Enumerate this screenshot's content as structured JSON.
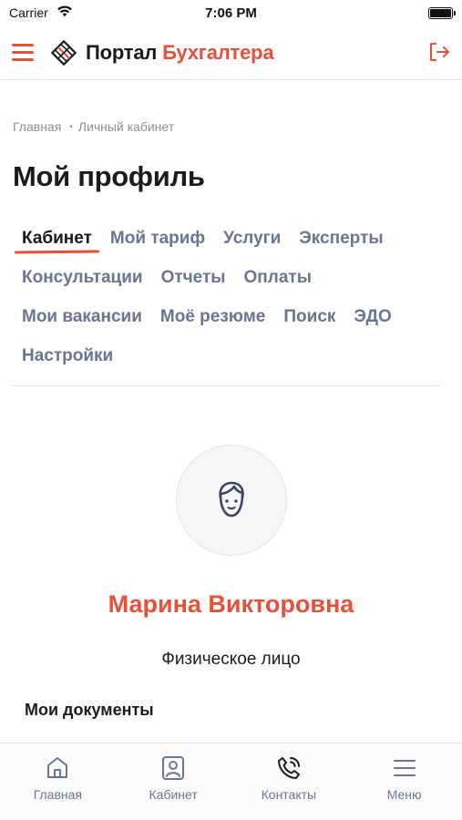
{
  "status_bar": {
    "carrier": "Carrier",
    "time": "7:06 PM",
    "battery_level": 1.0
  },
  "header": {
    "logo_text_primary": "Портал",
    "logo_text_accent": "Бухгалтера",
    "menu_icon": "hamburger-icon",
    "exit_icon": "logout-icon",
    "accent_color": "#e8503a"
  },
  "breadcrumb": {
    "home": "Главная",
    "current": "Личный кабинет"
  },
  "page_title": "Мой профиль",
  "tabs": [
    [
      {
        "label": "Кабинет",
        "active": true
      },
      {
        "label": "Мой тариф"
      },
      {
        "label": "Услуги"
      },
      {
        "label": "Эксперты"
      }
    ],
    [
      {
        "label": "Консультации"
      },
      {
        "label": "Отчеты"
      },
      {
        "label": "Оплаты"
      }
    ],
    [
      {
        "label": "Мои вакансии"
      },
      {
        "label": "Моё резюме"
      },
      {
        "label": "Поиск"
      },
      {
        "label": "ЭДО"
      }
    ],
    [
      {
        "label": "Настройки"
      }
    ]
  ],
  "profile": {
    "avatar_icon": "user-face-icon",
    "name": "Марина Викторовна",
    "type": "Физическое лицо"
  },
  "documents": {
    "title": "Мои документы"
  },
  "bottom_nav": [
    {
      "label": "Главная",
      "icon": "home-icon"
    },
    {
      "label": "Кабинет",
      "icon": "profile-card-icon"
    },
    {
      "label": "Контакты",
      "icon": "phone-call-icon"
    },
    {
      "label": "Меню",
      "icon": "menu-icon"
    }
  ]
}
